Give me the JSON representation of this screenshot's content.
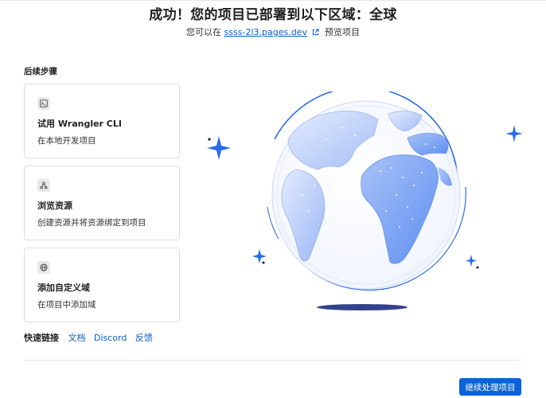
{
  "header": {
    "title": "成功！您的项目已部署到以下区域：全球",
    "subtitle_prefix": "您可以在",
    "subtitle_link": "ssss-2l3.pages.dev",
    "subtitle_suffix": "预览项目"
  },
  "next_steps": {
    "title": "后续步骤",
    "cards": [
      {
        "icon": "terminal-icon",
        "title": "试用 Wrangler CLI",
        "desc": "在本地开发项目"
      },
      {
        "icon": "resource-icon",
        "title": "浏览资源",
        "desc": "创建资源并将资源绑定到项目"
      },
      {
        "icon": "globe-icon",
        "title": "添加自定义域",
        "desc": "在项目中添加域"
      }
    ]
  },
  "quick_links": {
    "label": "快速链接",
    "links": [
      "文档",
      "Discord",
      "反馈"
    ]
  },
  "footer": {
    "continue_label": "继续处理项目"
  },
  "illustration": {
    "icon": "earth-globe-illustration",
    "accent": "#2a6be8",
    "ocean": "#ffffff",
    "land": "#7ea3f4"
  }
}
